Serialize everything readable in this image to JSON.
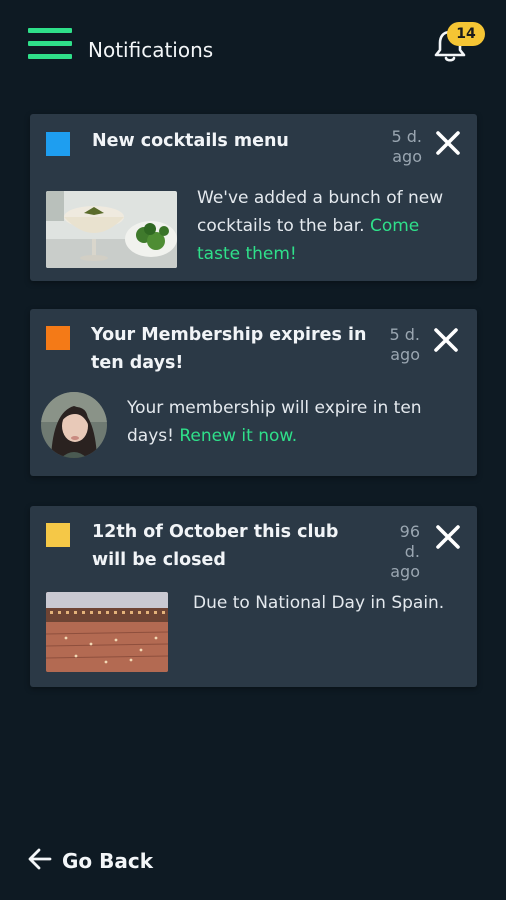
{
  "header": {
    "title": "Notifications",
    "badge_count": "14",
    "menu_icon": "hamburger-menu-icon",
    "bell_icon": "bell-icon"
  },
  "colors": {
    "background": "#0e1a23",
    "card": "#2b3946",
    "accent": "#2fe08a",
    "badge": "#f5c534"
  },
  "notifications": [
    {
      "color": "#1e9ef0",
      "title": "New cocktails menu",
      "time_value": "5 d.",
      "time_unit": "ago",
      "text": "We've added a bunch of new cocktails to the bar.",
      "link": "Come taste them!",
      "media": "cocktail-photo"
    },
    {
      "color": "#f47a17",
      "title": "Your Membership expires in ten days!",
      "time_value": "5 d.",
      "time_unit": "ago",
      "text": "Your membership will expire in ten days!",
      "link": "Renew it now.",
      "media": "user-avatar"
    },
    {
      "color": "#f5c847",
      "title": "12th of October this club will be closed",
      "time_value": "96 d.",
      "time_unit": "ago",
      "text": "Due to National Day in Spain.",
      "link": "",
      "media": "plaza-photo"
    }
  ],
  "footer": {
    "back_label": "Go Back",
    "back_icon": "arrow-left-icon"
  }
}
